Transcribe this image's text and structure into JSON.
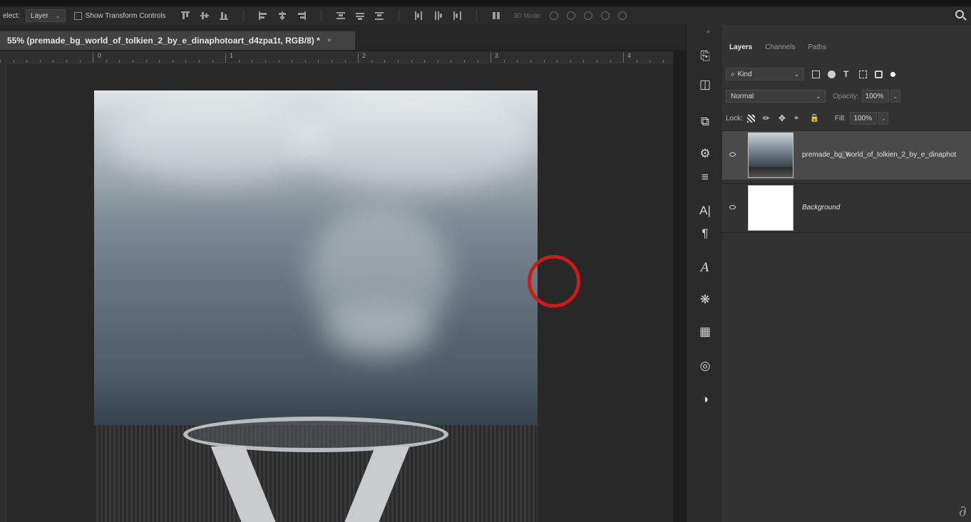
{
  "options_bar": {
    "select_label": "elect:",
    "select_target": "Layer",
    "show_transform_label": "Show Transform Controls",
    "mode_3d_label": "3D Mode:"
  },
  "document": {
    "tab_title": "55% (premade_bg_world_of_tolkien_2_by_e_dinaphotoart_d4zpa1t, RGB/8) *",
    "close_glyph": "×"
  },
  "ruler": {
    "labels": [
      "0",
      "1",
      "2",
      "3",
      "4"
    ]
  },
  "toolstrip": {
    "collapse_glyph": "«",
    "icons": [
      "history-icon",
      "properties-icon",
      "libraries-icon",
      "brush-settings-icon",
      "adjust-icon",
      "character-icon",
      "paragraph-icon",
      "glyphs-icon",
      "swatches-icon",
      "grid-icon",
      "cc-libraries-icon",
      "adjustments-icon"
    ]
  },
  "layers_panel": {
    "tabs": [
      "Layers",
      "Channels",
      "Paths"
    ],
    "filter_label": "Kind",
    "blend_mode": "Normal",
    "opacity_label": "Opacity:",
    "opacity_value": "100%",
    "lock_label": "Lock:",
    "fill_label": "Fill:",
    "fill_value": "100%",
    "layers": [
      {
        "name": "premade_bg_world_of_tolkien_2_by_e_dinaphot",
        "selected": true,
        "visible": true
      },
      {
        "name": "Background",
        "selected": false,
        "visible": true
      }
    ]
  },
  "colors": {
    "accent_ring": "#d0191a",
    "panel_bg": "#323232",
    "canvas_bg": "#282828"
  }
}
